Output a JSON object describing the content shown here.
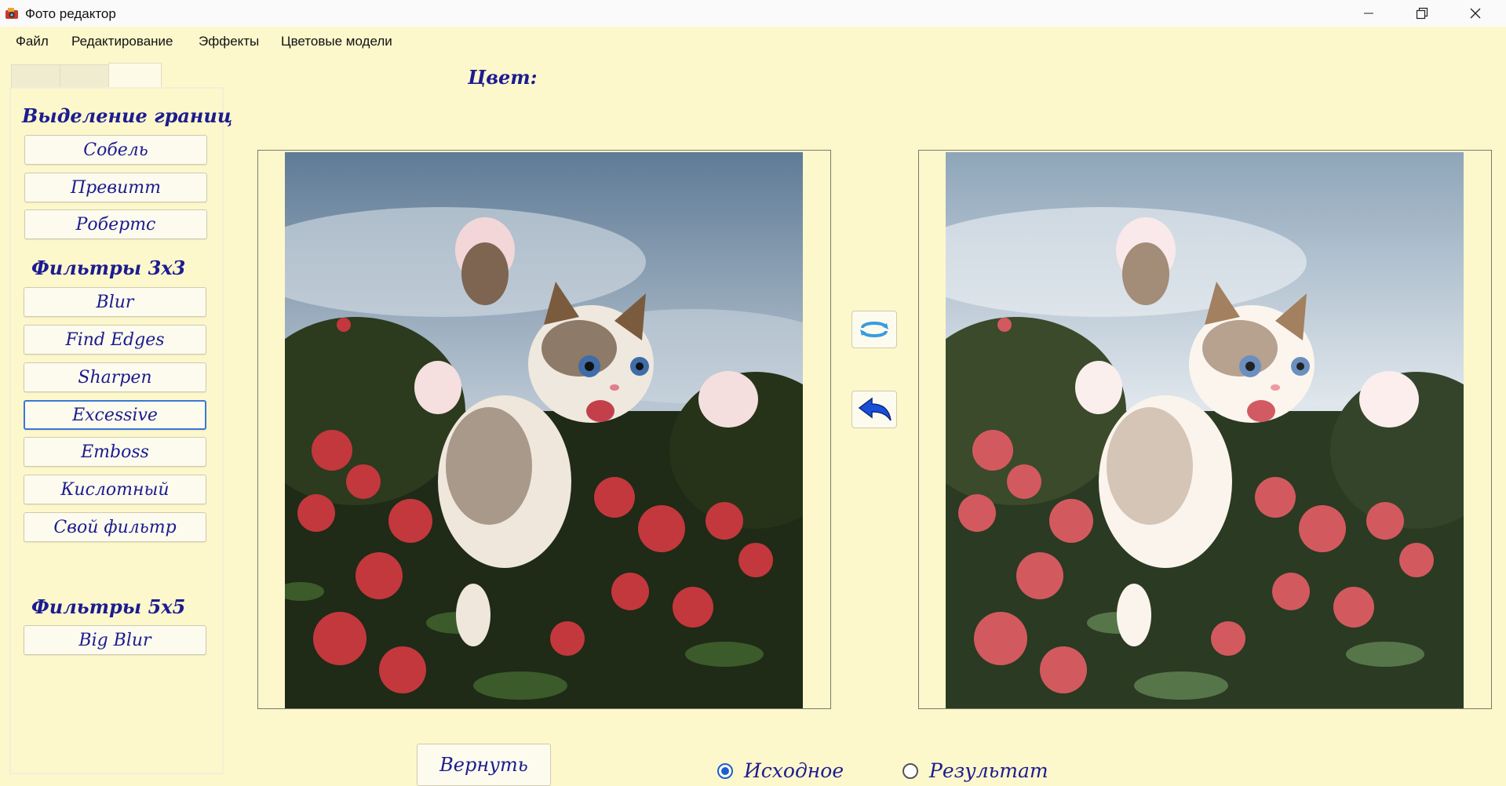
{
  "window": {
    "title": "Фото редактор"
  },
  "menu": [
    "Файл",
    "Редактирование",
    "Эффекты",
    "Цветовые модели"
  ],
  "tabs": [
    "",
    "",
    ""
  ],
  "sections": {
    "edges": {
      "title": "Выделение границ",
      "buttons": [
        "Собель",
        "Превитт",
        "Робертс"
      ]
    },
    "filters3": {
      "title": "Фильтры 3x3",
      "buttons": [
        "Blur",
        "Find Edges",
        "Sharpen",
        "Excessive",
        "Emboss",
        "Кислотный",
        "Свой фильтр"
      ],
      "selected": "Excessive"
    },
    "filters5": {
      "title": "Фильтры 5x5",
      "buttons": [
        "Big Blur"
      ]
    }
  },
  "color_label": "Цвет:",
  "controls": {
    "swap_icon": "swap-arrows-icon",
    "apply_icon": "back-arrow-icon",
    "return_label": "Вернуть"
  },
  "radio": {
    "options": [
      "Исходное",
      "Результат"
    ],
    "selected": "Исходное"
  },
  "colors": {
    "background": "#fdf7cc",
    "text_accent": "#1c1c90",
    "selected_border": "#3a78d8"
  }
}
